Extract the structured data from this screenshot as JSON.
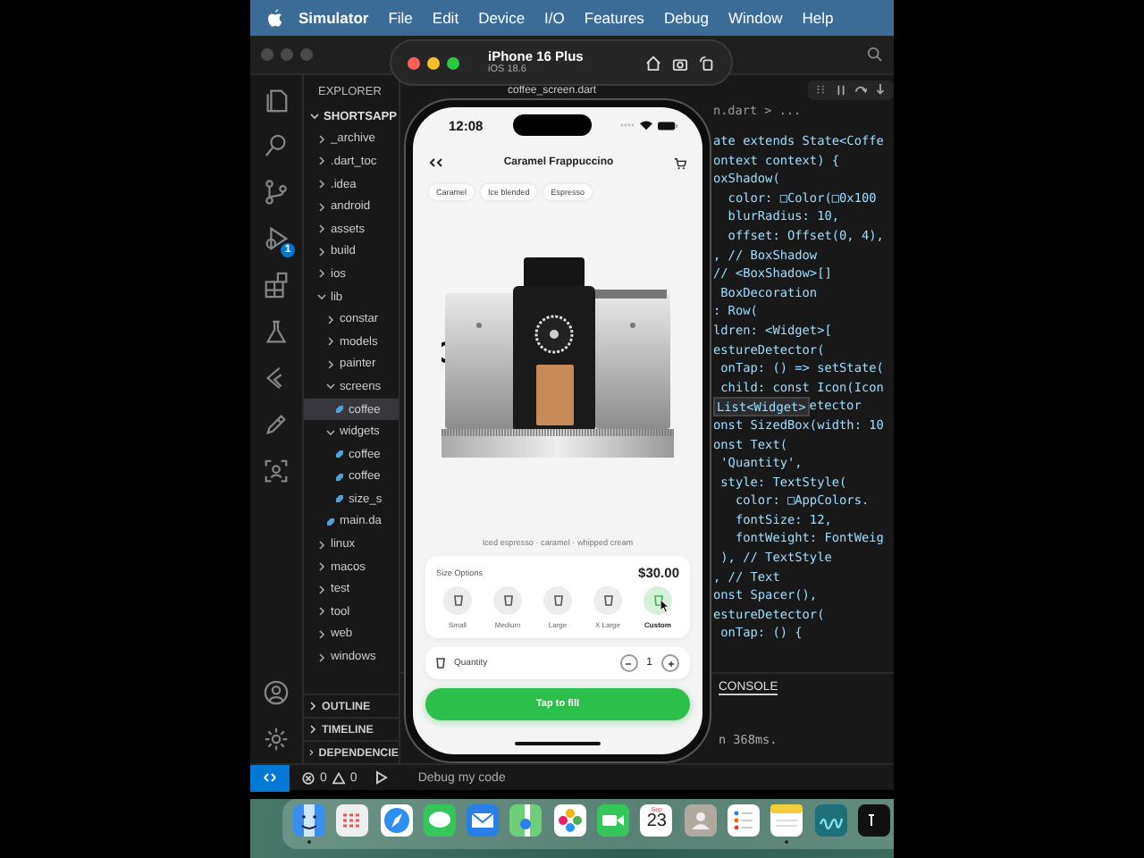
{
  "menu_bar": {
    "app": "Simulator",
    "items": [
      "File",
      "Edit",
      "Device",
      "I/O",
      "Features",
      "Debug",
      "Window",
      "Help"
    ]
  },
  "editor_window": {
    "explorer": {
      "title": "EXPLORER",
      "project": {
        "label": "SHORTSAPP",
        "expanded": true
      },
      "tree": [
        {
          "label": "_archive",
          "kind": "folder",
          "expanded": false,
          "selected": false
        },
        {
          "label": ".dart_toc",
          "kind": "folder",
          "expanded": false,
          "selected": false
        },
        {
          "label": ".idea",
          "kind": "folder",
          "expanded": false,
          "selected": false
        },
        {
          "label": "android",
          "kind": "folder",
          "expanded": false,
          "selected": false
        },
        {
          "label": "assets",
          "kind": "folder",
          "expanded": false,
          "selected": false
        },
        {
          "label": "build",
          "kind": "folder",
          "expanded": false,
          "selected": false
        },
        {
          "label": "ios",
          "kind": "folder",
          "expanded": false,
          "selected": false
        },
        {
          "label": "lib",
          "kind": "folder",
          "expanded": true,
          "selected": false,
          "children": [
            {
              "label": "constar",
              "kind": "folder",
              "expanded": false,
              "selected": false
            },
            {
              "label": "models",
              "kind": "folder",
              "expanded": false,
              "selected": false
            },
            {
              "label": "painter",
              "kind": "folder",
              "expanded": false,
              "selected": false
            },
            {
              "label": "screens",
              "kind": "folder",
              "expanded": true,
              "selected": false,
              "children": [
                {
                  "label": "coffee",
                  "kind": "file",
                  "selected": true
                }
              ]
            },
            {
              "label": "widgets",
              "kind": "folder",
              "expanded": true,
              "selected": false,
              "children": [
                {
                  "label": "coffee",
                  "kind": "file",
                  "selected": false
                },
                {
                  "label": "coffee",
                  "kind": "file",
                  "selected": false
                },
                {
                  "label": "size_s",
                  "kind": "file",
                  "selected": false
                }
              ]
            },
            {
              "label": "main.da",
              "kind": "file",
              "selected": false
            }
          ]
        },
        {
          "label": "linux",
          "kind": "folder",
          "expanded": false,
          "selected": false
        },
        {
          "label": "macos",
          "kind": "folder",
          "expanded": false,
          "selected": false
        },
        {
          "label": "test",
          "kind": "folder",
          "expanded": false,
          "selected": false
        },
        {
          "label": "tool",
          "kind": "folder",
          "expanded": false,
          "selected": false
        },
        {
          "label": "web",
          "kind": "folder",
          "expanded": false,
          "selected": false
        },
        {
          "label": "windows",
          "kind": "folder",
          "expanded": false,
          "selected": false
        }
      ],
      "sections": [
        {
          "label": "OUTLINE",
          "expanded": false
        },
        {
          "label": "TIMELINE",
          "expanded": false
        },
        {
          "label": "DEPENDENCIE",
          "expanded": false
        }
      ]
    },
    "debug_badge": "1",
    "tab": "coffee_screen.dart",
    "breadcrumb": "n.dart > ...",
    "code_lines": [
      {
        "text": "ate extends State<Coffe"
      },
      {
        "text": "ontext context) {"
      },
      {
        "text": "oxShadow("
      },
      {
        "text": "  color: □Color(□0x100"
      },
      {
        "text": "  blurRadius: 10,"
      },
      {
        "text": "  offset: Offset(0, 4),"
      },
      {
        "text": ", // BoxShadow"
      },
      {
        "text": "// <BoxShadow>[]"
      },
      {
        "text": " BoxDecoration"
      },
      {
        "text": ": Row("
      },
      {
        "text": "ldren: <Widget>["
      },
      {
        "text": "estureDetector("
      },
      {
        "text": " onTap: () => setState("
      },
      {
        "text": " child: const Icon(Icon"
      },
      {
        "text": "etector",
        "hint": "List<Widget>"
      },
      {
        "text": "onst SizedBox(width: 10"
      },
      {
        "text": "onst Text("
      },
      {
        "text": " 'Quantity',"
      },
      {
        "text": " style: TextStyle("
      },
      {
        "text": "   color: □AppColors."
      },
      {
        "text": "   fontSize: 12,"
      },
      {
        "text": "   fontWeight: FontWeig"
      },
      {
        "text": " ), // TextStyle"
      },
      {
        "text": ", // Text"
      },
      {
        "text": "onst Spacer(),"
      },
      {
        "text": "estureDetector("
      },
      {
        "text": " onTap: () {"
      }
    ],
    "panel_tab": "CONSOLE",
    "console_line": "n 368ms.",
    "status_bar": {
      "errors": "0",
      "warnings": "0",
      "debug_label": "Debug my code"
    }
  },
  "simulator": {
    "device": "iPhone 16 Plus",
    "os": "iOS 18.6"
  },
  "app": {
    "time": "12:08",
    "title": "Caramel Frappuccino",
    "tags": [
      "Caramel",
      "Ice blended",
      "Espresso"
    ],
    "description": "Iced espresso · caramel · whipped cream",
    "size_title": "Size Options",
    "price": "$30.00",
    "sizes": [
      {
        "label": "Small",
        "selected": false
      },
      {
        "label": "Medium",
        "selected": false
      },
      {
        "label": "Large",
        "selected": false
      },
      {
        "label": "X Large",
        "selected": false
      },
      {
        "label": "Custom",
        "selected": true
      }
    ],
    "quantity_label": "Quantity",
    "quantity": "1",
    "fill_button": "Tap to fill"
  },
  "dock": {
    "apps": [
      {
        "kind": "finder",
        "running": true
      },
      {
        "kind": "launchpad",
        "running": false
      },
      {
        "kind": "safari",
        "running": false
      },
      {
        "kind": "messages",
        "running": false
      },
      {
        "kind": "mail",
        "running": false
      },
      {
        "kind": "maps",
        "running": false
      },
      {
        "kind": "photos",
        "running": false
      },
      {
        "kind": "facetime",
        "running": false
      },
      {
        "kind": "calendar",
        "running": false,
        "month": "Sep",
        "day": "23"
      },
      {
        "kind": "contacts",
        "running": false
      },
      {
        "kind": "reminders",
        "running": false
      },
      {
        "kind": "notes",
        "running": true
      },
      {
        "kind": "freeform",
        "running": false
      },
      {
        "kind": "tv",
        "running": false
      }
    ]
  }
}
